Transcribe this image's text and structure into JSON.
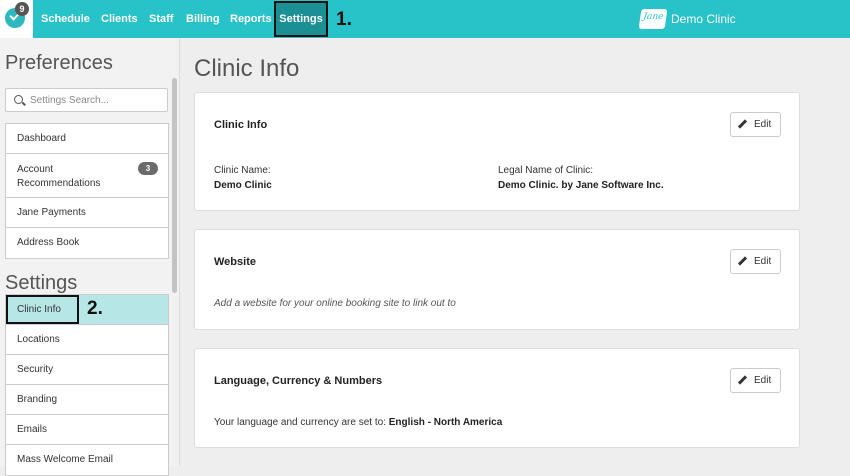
{
  "topbar": {
    "notification_count": "9",
    "nav": [
      "Schedule",
      "Clients",
      "Staff",
      "Billing",
      "Reports",
      "Settings"
    ],
    "step1": "1.",
    "brand_icon_text": "Jane",
    "brand_name": "Demo Clinic",
    "accent_color": "#28c3c8"
  },
  "sidebar": {
    "preferences_heading": "Preferences",
    "search_placeholder": "Settings Search...",
    "preferences_items": [
      {
        "label": "Dashboard"
      },
      {
        "label": "Account Recommendations",
        "count": "3"
      },
      {
        "label": "Jane Payments"
      },
      {
        "label": "Address Book"
      }
    ],
    "settings_heading": "Settings",
    "step2": "2.",
    "settings_items": [
      {
        "label": "Clinic Info",
        "active": true
      },
      {
        "label": "Locations"
      },
      {
        "label": "Security"
      },
      {
        "label": "Branding"
      },
      {
        "label": "Emails"
      },
      {
        "label": "Mass Welcome Email"
      }
    ]
  },
  "main": {
    "title": "Clinic Info",
    "edit_label": "Edit",
    "clinic_card": {
      "heading": "Clinic Info",
      "name_label": "Clinic Name:",
      "name_value": "Demo Clinic",
      "legal_label": "Legal Name of Clinic:",
      "legal_value": "Demo Clinic. by Jane Software Inc."
    },
    "website_card": {
      "heading": "Website",
      "hint": "Add a website for your online booking site to link out to"
    },
    "language_card": {
      "heading": "Language, Currency & Numbers",
      "prefix": "Your language and currency are set to:",
      "value": "English - North America"
    }
  }
}
